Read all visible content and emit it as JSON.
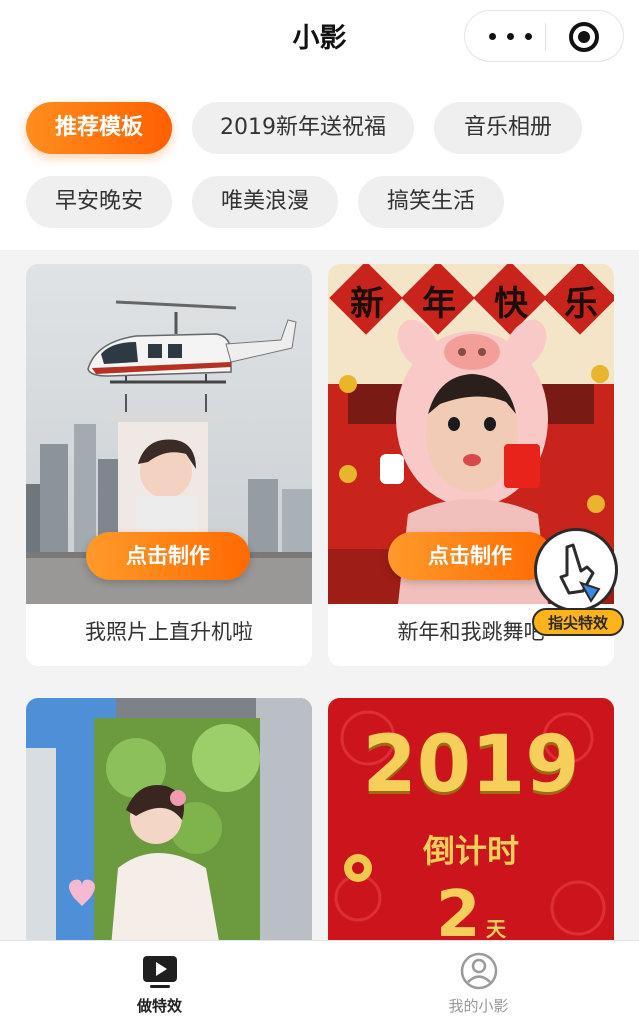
{
  "app": {
    "title": "小影"
  },
  "capsule": {
    "more_icon": "more-dots-icon",
    "close_icon": "target-circle-icon"
  },
  "tags": [
    {
      "label": "推荐模板",
      "active": true
    },
    {
      "label": "2019新年送祝福",
      "active": false
    },
    {
      "label": "音乐相册",
      "active": false
    },
    {
      "label": "早安晚安",
      "active": false
    },
    {
      "label": "唯美浪漫",
      "active": false
    },
    {
      "label": "搞笑生活",
      "active": false
    }
  ],
  "cards": [
    {
      "caption": "我照片上直升机啦",
      "button": "点击制作"
    },
    {
      "caption": "新年和我跳舞吧",
      "button": "点击制作",
      "banner": [
        "新",
        "年",
        "快",
        "乐"
      ]
    },
    {
      "caption": "",
      "button": ""
    },
    {
      "caption": "",
      "button": "",
      "poster_year": "2019",
      "poster_sub": "倒计时",
      "poster_num": "2",
      "poster_unit": "天"
    }
  ],
  "badge": {
    "label": "指尖特效"
  },
  "nav": [
    {
      "label": "做特效",
      "icon": "play-video-icon",
      "active": true
    },
    {
      "label": "我的小影",
      "icon": "profile-icon",
      "active": false
    }
  ],
  "colors": {
    "accent": "#ff6a00",
    "active_text": "#222222",
    "inactive_text": "#999999"
  }
}
